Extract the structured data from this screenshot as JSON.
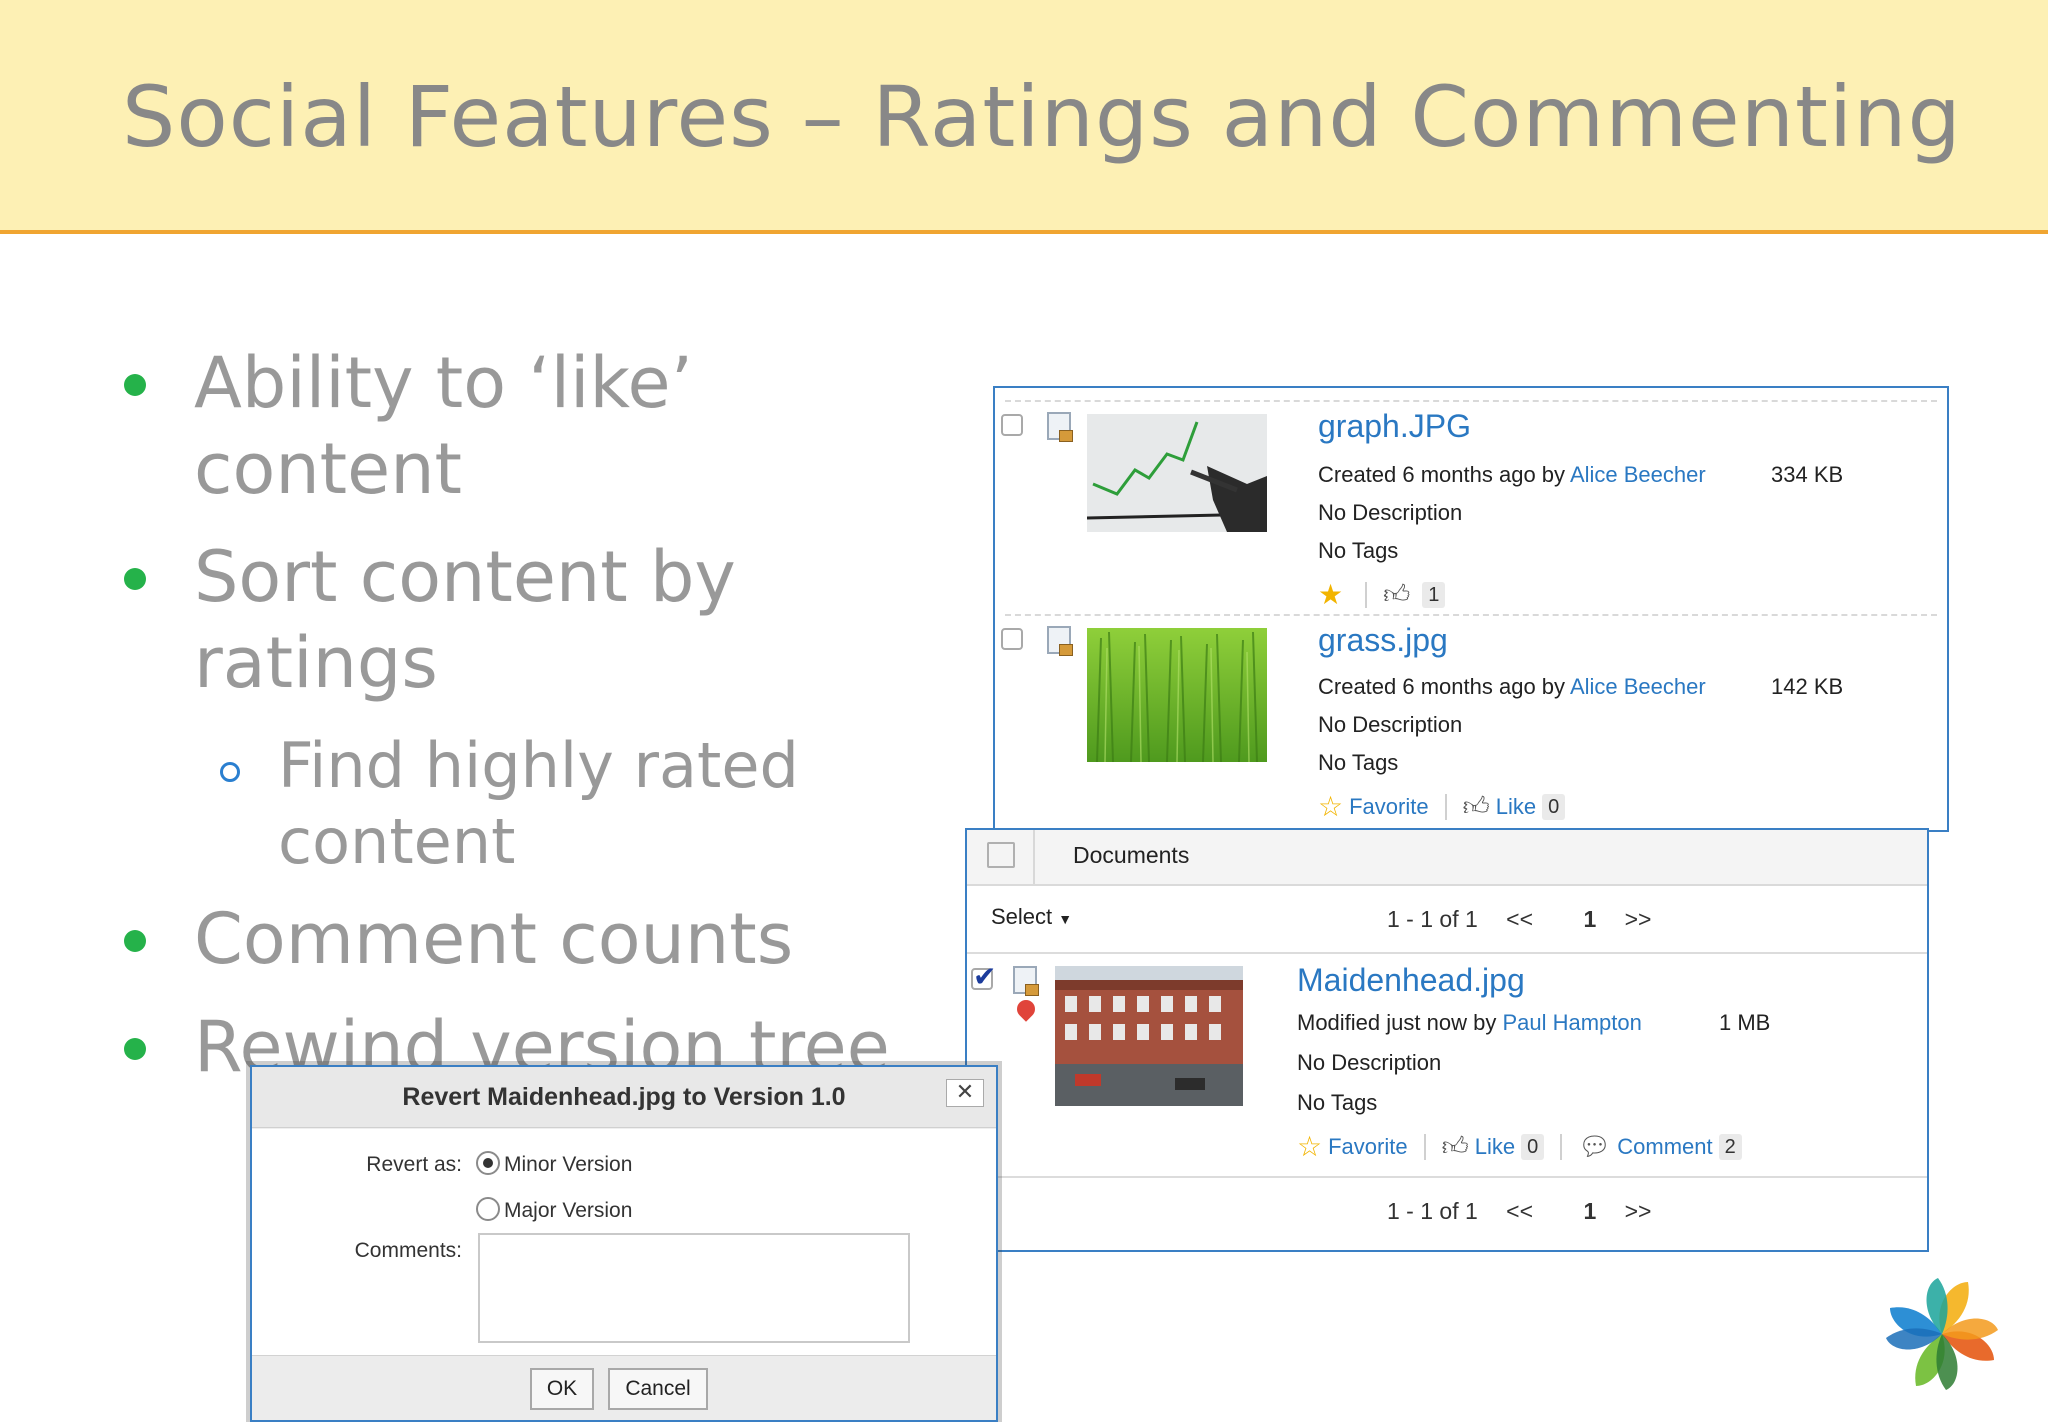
{
  "slide": {
    "title": "Social Features – Ratings and Commenting",
    "bullets": [
      {
        "line1": "Ability to ‘like’",
        "line2": "content"
      },
      {
        "line1": "Sort content by",
        "line2": "ratings"
      },
      {
        "line1": "Comment counts"
      },
      {
        "line1": "Rewind version tree"
      }
    ],
    "sub_bullet": {
      "line1": "Find highly rated",
      "line2": "content"
    }
  },
  "panel_a": {
    "items": [
      {
        "name": "graph.JPG",
        "meta_prefix": "Created 6 months ago by",
        "author": "Alice Beecher",
        "size": "334 KB",
        "description": "No Description",
        "tags": "No Tags",
        "like_count": "1"
      },
      {
        "name": "grass.jpg",
        "meta_prefix": "Created 6 months ago by",
        "author": "Alice Beecher",
        "size": "142 KB",
        "description": "No Description",
        "tags": "No Tags",
        "favorite_label": "Favorite",
        "like_label": "Like",
        "like_count": "0"
      }
    ]
  },
  "panel_b": {
    "header_title": "Documents",
    "select_label": "Select",
    "pager": {
      "range": "1 - 1 of 1",
      "prev": "<<",
      "page": "1",
      "next": ">>"
    },
    "item": {
      "name": "Maidenhead.jpg",
      "meta_prefix": "Modified just now by",
      "author": "Paul Hampton",
      "size": "1 MB",
      "description": "No Description",
      "tags": "No Tags",
      "favorite_label": "Favorite",
      "like_label": "Like",
      "like_count": "0",
      "comment_label": "Comment",
      "comment_count": "2"
    }
  },
  "dialog": {
    "title": "Revert Maidenhead.jpg to Version 1.0",
    "close": "✕",
    "revert_as_label": "Revert as:",
    "minor_label": "Minor Version",
    "major_label": "Major Version",
    "comments_label": "Comments:",
    "ok_label": "OK",
    "cancel_label": "Cancel",
    "selected_option": "Minor Version"
  },
  "colors": {
    "banner": "#fdf0b4",
    "banner_rule": "#f0a531",
    "bullet_dot": "#25b24a",
    "link": "#2a78c2",
    "panel_border": "#3a7fc4"
  },
  "icons": [
    "star-icon",
    "thumbs-up-icon",
    "comment-icon",
    "file-image-icon",
    "close-icon",
    "dropdown-arrow-icon",
    "checkbox-icon"
  ]
}
